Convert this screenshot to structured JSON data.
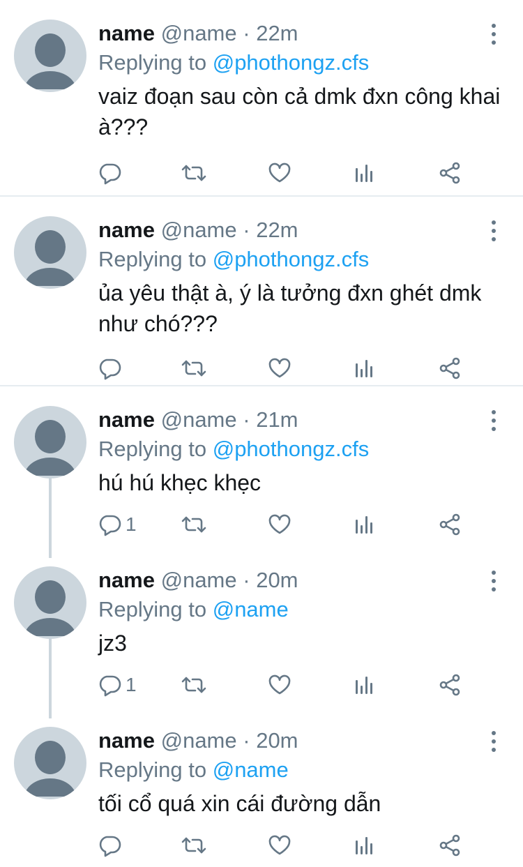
{
  "colors": {
    "text": "#14171a",
    "secondary": "#657786",
    "link": "#1da1f2",
    "divider": "#e6ecf0",
    "avatar_bg": "#ccd6dd",
    "avatar_fg": "#657786"
  },
  "icons": {
    "reply": "reply-icon",
    "retweet": "retweet-icon",
    "like": "heart-icon",
    "analytics": "analytics-icon",
    "share": "share-icon",
    "more": "more-vertical-icon",
    "avatar": "default-avatar-icon"
  },
  "tweets": [
    {
      "name": "name",
      "handle": "@name",
      "dot": "·",
      "time": "22m",
      "replying_prefix": "Replying to",
      "replying_to": "@phothongz.cfs",
      "text": "vaiz đoạn sau còn cả dmk đxn công khai à???",
      "reply_count": ""
    },
    {
      "name": "name",
      "handle": "@name",
      "dot": "·",
      "time": "22m",
      "replying_prefix": "Replying to",
      "replying_to": "@phothongz.cfs",
      "text": "ủa yêu thật à, ý là tưởng đxn ghét dmk như chó???",
      "reply_count": ""
    },
    {
      "name": "name",
      "handle": "@name",
      "dot": "·",
      "time": "21m",
      "replying_prefix": "Replying to",
      "replying_to": "@phothongz.cfs",
      "text": "hú hú khẹc khẹc",
      "reply_count": "1"
    },
    {
      "name": "name",
      "handle": "@name",
      "dot": "·",
      "time": "20m",
      "replying_prefix": "Replying to",
      "replying_to": "@name",
      "text": "jz3",
      "reply_count": "1"
    },
    {
      "name": "name",
      "handle": "@name",
      "dot": "·",
      "time": "20m",
      "replying_prefix": "Replying to",
      "replying_to": "@name",
      "text": "tối cổ quá xin cái đường dẫn",
      "reply_count": ""
    }
  ]
}
